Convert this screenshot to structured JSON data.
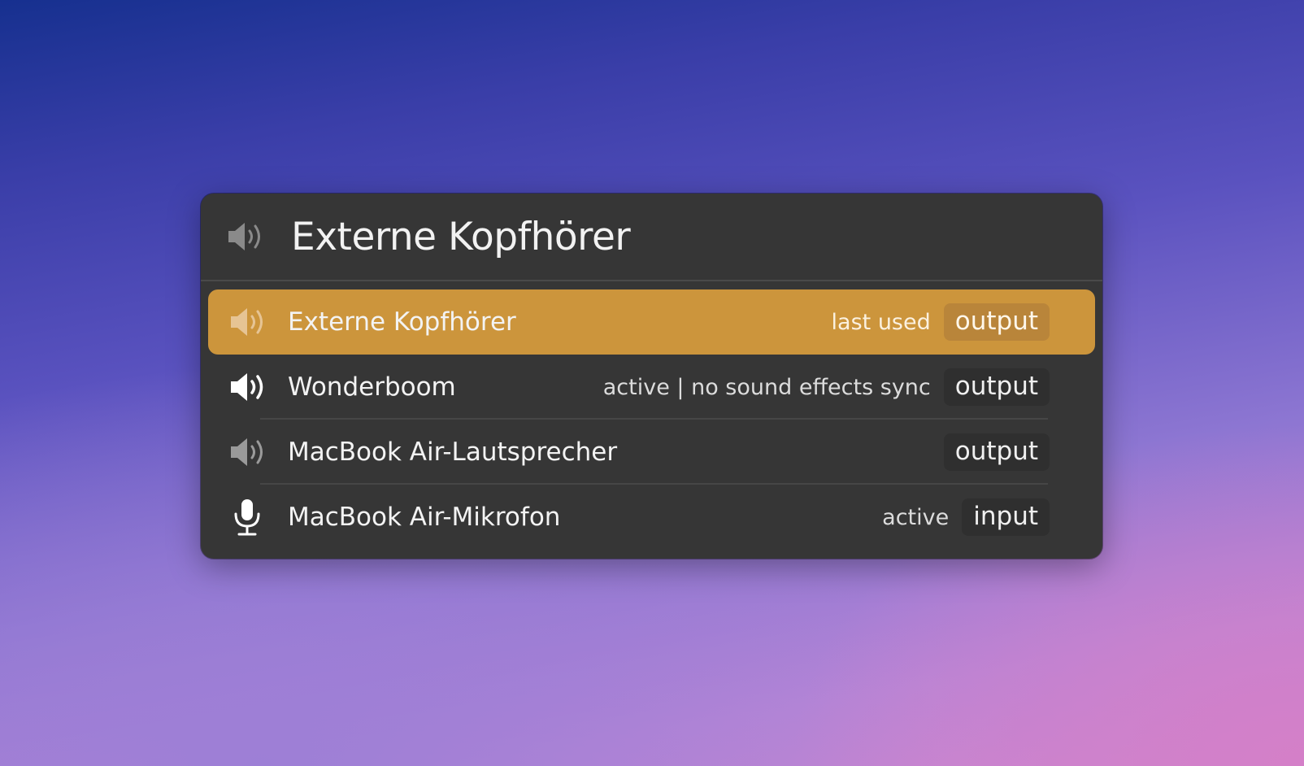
{
  "header": {
    "icon": "speaker-icon",
    "title": "Externe Kopfhörer"
  },
  "devices": [
    {
      "icon": "speaker-icon",
      "label": "Externe Kopfhörer",
      "status": "last used",
      "type": "output",
      "selected": true
    },
    {
      "icon": "speaker-icon",
      "label": "Wonderboom",
      "status": "active | no sound effects sync",
      "type": "output",
      "selected": false
    },
    {
      "icon": "speaker-icon",
      "label": "MacBook Air-Lautsprecher",
      "status": "",
      "type": "output",
      "selected": false
    },
    {
      "icon": "microphone-icon",
      "label": "MacBook Air-Mikrofon",
      "status": "active",
      "type": "input",
      "selected": false
    }
  ],
  "colors": {
    "selection": "#cc953c",
    "panel": "#363636"
  }
}
